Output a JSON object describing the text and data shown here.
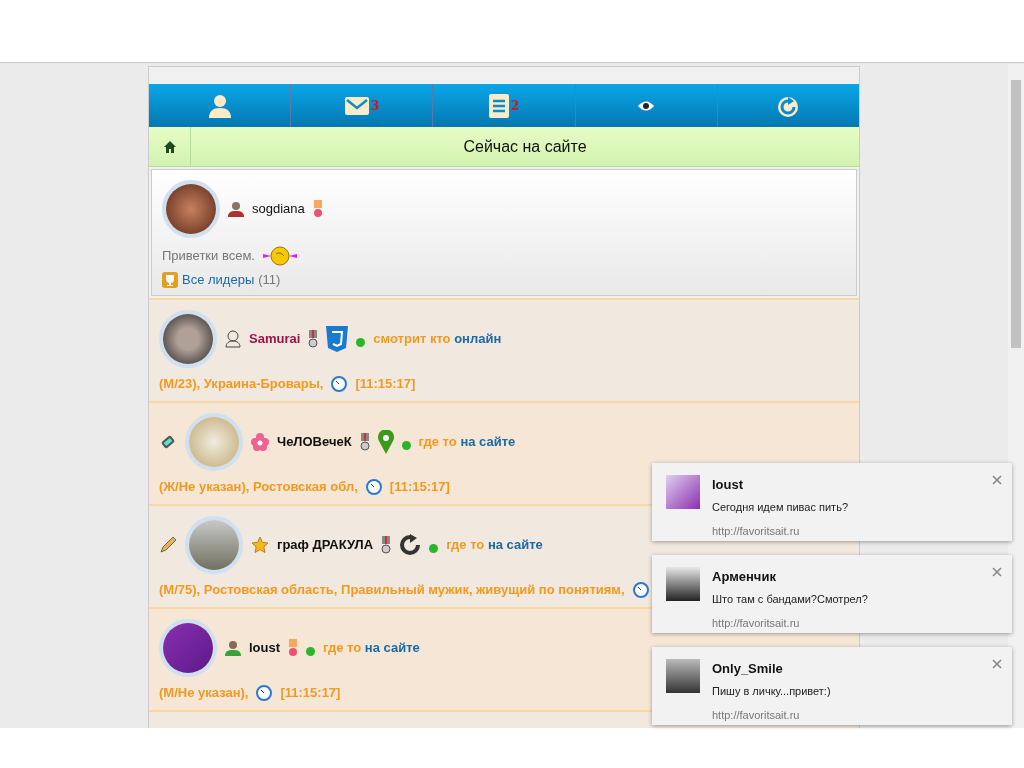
{
  "tabs": [
    {
      "kind": "user"
    },
    {
      "kind": "mail",
      "count": "3"
    },
    {
      "kind": "list",
      "count": "2"
    },
    {
      "kind": "eye"
    },
    {
      "kind": "refresh"
    }
  ],
  "header": {
    "title": "Сейчас на сайте"
  },
  "leader": {
    "name": "sogdiana",
    "status": "Приветки всем.",
    "link": "Все лидеры",
    "count": "(11)"
  },
  "users": [
    {
      "role": {
        "kind": "outline"
      },
      "name": "Samurai",
      "color": "#a0104a",
      "badges": [
        {
          "kind": "medal"
        },
        {
          "kind": "css"
        }
      ],
      "activity": "смотрит кто",
      "place": "онлайн",
      "info": "(М/23), Украина-Бровары,",
      "time": "[11:15:17]"
    },
    {
      "left": {
        "kind": "phone"
      },
      "role": {
        "kind": "flower"
      },
      "name": "ЧеЛОВечеК",
      "color": "#111111",
      "badges": [
        {
          "kind": "medal"
        },
        {
          "kind": "pin"
        }
      ],
      "activity": "где то",
      "place": "на сайте",
      "info": "(Ж/Не указан), Ростовская обл,",
      "time": "[11:15:17]"
    },
    {
      "left": {
        "kind": "pencil"
      },
      "role": {
        "kind": "star"
      },
      "name": "граф ДРАКУЛА",
      "color": "#111111",
      "badges": [
        {
          "kind": "medal"
        },
        {
          "kind": "refresh"
        }
      ],
      "activity": "где то",
      "place": "на сайте",
      "info": "(М/75), Ростовская область, Правильный мужик, живущий по понятиям,"
    },
    {
      "role": {
        "kind": "person"
      },
      "name": "loust",
      "color": "#111111",
      "badges": [
        {
          "kind": "ribbon"
        }
      ],
      "activity": "где то",
      "place": "на сайте",
      "info": "(М/Не указан),",
      "time": "[11:15:17]"
    }
  ],
  "notifications": [
    {
      "title": "loust",
      "message": "Сегодня идем пивас пить?",
      "site": "http://favoritsait.ru"
    },
    {
      "title": "Арменчик",
      "message": "Што там с бандами?Смотрел?",
      "site": "http://favoritsait.ru"
    },
    {
      "title": "Only_Smile",
      "message": "Пишу в личку...привет:)",
      "site": "http://favoritsait.ru"
    }
  ]
}
